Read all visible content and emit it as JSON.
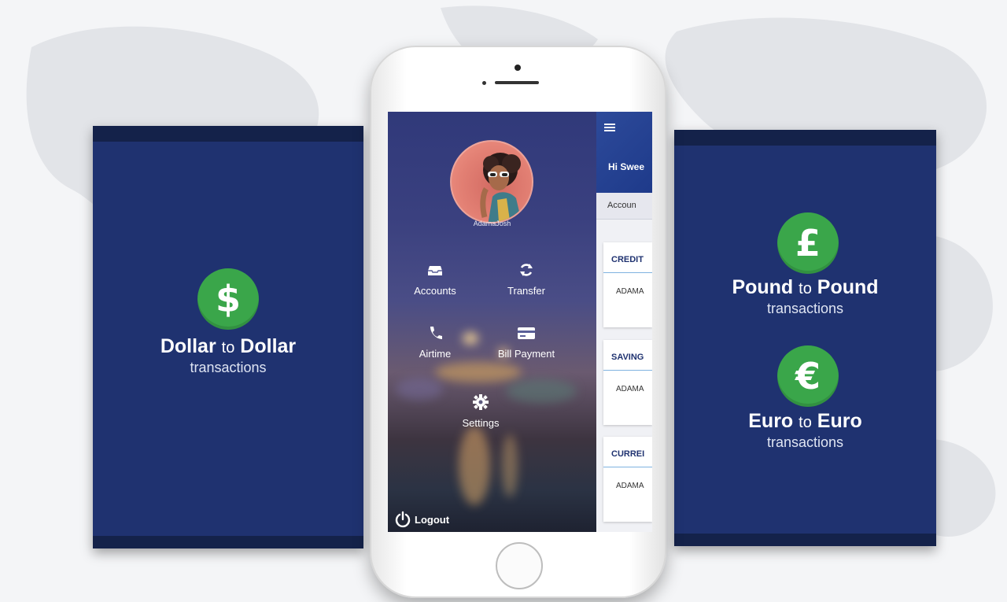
{
  "panels": {
    "left": {
      "symbol": "$",
      "title_strong_1": "Dollar",
      "title_small": "to",
      "title_strong_2": "Dollar",
      "subtitle": "transactions"
    },
    "right_top": {
      "symbol": "£",
      "title_strong_1": "Pound",
      "title_small": "to",
      "title_strong_2": "Pound",
      "subtitle": "transactions"
    },
    "right_bottom": {
      "symbol": "€",
      "title_strong_1": "Euro",
      "title_small": "to",
      "title_strong_2": "Euro",
      "subtitle": "transactions"
    }
  },
  "drawer": {
    "username": "AdamaJosh",
    "menu": [
      {
        "label": "Accounts",
        "icon": "inbox-icon"
      },
      {
        "label": "Transfer",
        "icon": "refresh-icon"
      },
      {
        "label": "Airtime",
        "icon": "phone-icon"
      },
      {
        "label": "Bill Payment",
        "icon": "credit-card-icon"
      },
      {
        "label": "Settings",
        "icon": "gear-icon"
      }
    ],
    "logout_label": "Logout"
  },
  "main": {
    "greeting": "Hi Swee",
    "tab_label": "Accoun",
    "cards": [
      {
        "title": "CREDIT",
        "name": "ADAMA"
      },
      {
        "title": "SAVING",
        "name": "ADAMA"
      },
      {
        "title": "CURREI",
        "name": "ADAMA"
      }
    ]
  },
  "colors": {
    "panel_blue": "#1f3270",
    "coin_green": "#3aa64a",
    "drawer_top": "#30397a",
    "topbar_blue": "#1e3a8a"
  }
}
